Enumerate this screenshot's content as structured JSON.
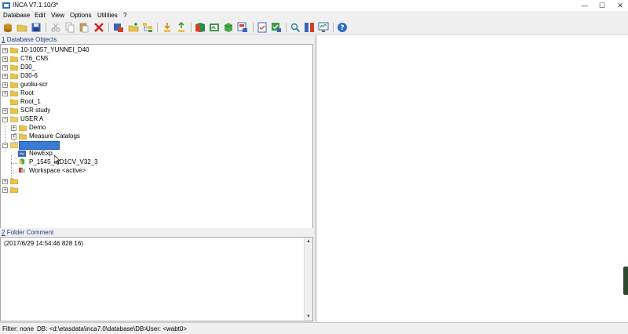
{
  "window": {
    "title": "INCA V7.1.10/3*",
    "controls": {
      "minimize": "—",
      "maximize": "☐",
      "close": "✕"
    }
  },
  "menu": [
    "Database",
    "Edit",
    "View",
    "Options",
    "Utilities",
    "?"
  ],
  "toolbar_icons": [
    "new-database-icon",
    "open-folder-icon",
    "save-icon",
    "cut-icon",
    "copy-icon",
    "paste-icon",
    "delete-icon",
    "new-experiment-icon",
    "new-folder-icon",
    "hierarchy-icon",
    "import-icon",
    "export-icon",
    "project-icon",
    "calibration-icon",
    "workspace-icon",
    "device-icon",
    "checklist-icon",
    "check-icon",
    "search-icon",
    "compare-icon",
    "monitor-icon",
    "help-icon"
  ],
  "database_objects": {
    "header_number": "1",
    "header_label": "Database Objects",
    "tree": [
      {
        "label": "10-10057_YUNNEI_D40"
      },
      {
        "label": "CT6_CN5"
      },
      {
        "label": "D30_"
      },
      {
        "label": "D30-6"
      },
      {
        "label": "guoliu-scr"
      },
      {
        "label": "Root"
      },
      {
        "label": "Root_1"
      },
      {
        "label": "SCR study"
      },
      {
        "label": "USER A"
      },
      {
        "label": "Demo"
      },
      {
        "label": "Measure Catalogs"
      },
      {
        "label": ""
      },
      {
        "label": "NewExp"
      },
      {
        "label": "P_1545_MD1CV_V32_3"
      },
      {
        "label": "Workspace <active>"
      },
      {
        "label": ""
      },
      {
        "label": ""
      }
    ]
  },
  "folder_comment": {
    "header_number": "2",
    "header_label": "Folder Comment",
    "text": "(2017/6/29 14:54:46 828 16)"
  },
  "status": {
    "filter": "Filter: none",
    "db": "DB: <d:\\etasdata\\inca7.0\\database\\DB>",
    "user": "User: <wabt0>"
  },
  "colors": {
    "folder": "#e8c44a",
    "selection": "#3a7bd5",
    "header_text": "#1a3c8c"
  }
}
